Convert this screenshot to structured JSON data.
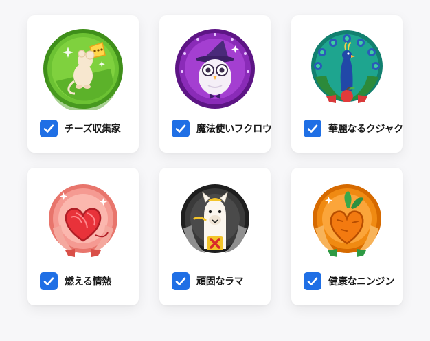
{
  "badges": [
    {
      "label": "チーズ収集家",
      "checked": true,
      "icon": "mouse-cheese-icon",
      "color": "#5fb52a"
    },
    {
      "label": "魔法使いフクロウ",
      "checked": true,
      "icon": "wizard-owl-icon",
      "color": "#8a2bb8"
    },
    {
      "label": "華麗なるクジャク",
      "checked": true,
      "icon": "peacock-icon",
      "color": "#1a9c8f"
    },
    {
      "label": "燃える情熱",
      "checked": true,
      "icon": "yarn-heart-icon",
      "color": "#f08a84"
    },
    {
      "label": "頑固なラマ",
      "checked": true,
      "icon": "llama-icon",
      "color": "#3a3a3a"
    },
    {
      "label": "健康なニンジン",
      "checked": true,
      "icon": "carrot-heart-icon",
      "color": "#f08a12"
    }
  ]
}
